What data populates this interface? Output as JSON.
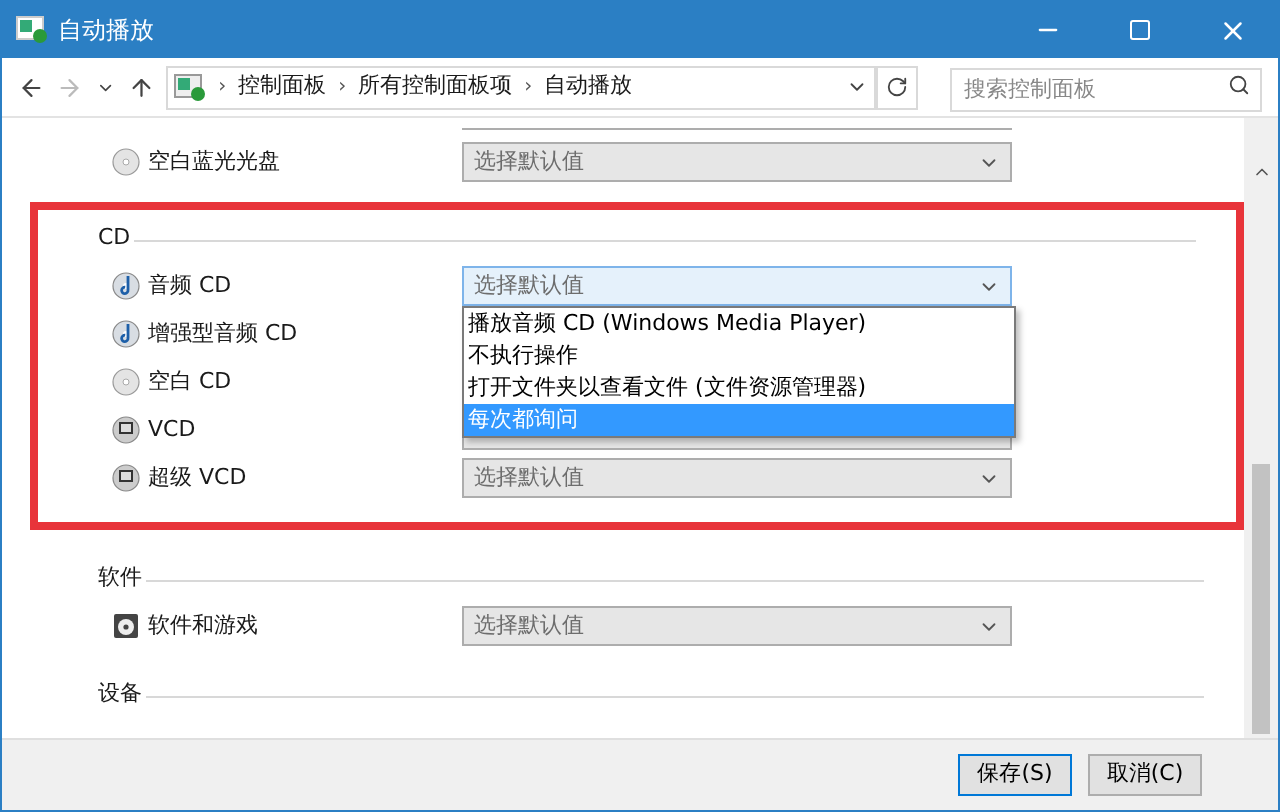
{
  "window": {
    "title": "自动播放"
  },
  "address_bar": {
    "separator": "›",
    "breadcrumbs": [
      "控制面板",
      "所有控制面板项",
      "自动播放"
    ]
  },
  "search": {
    "placeholder": "搜索控制面板"
  },
  "top_row": {
    "label": "空白蓝光光盘",
    "kind": "blank",
    "dropdown": "选择默认值",
    "focused": false
  },
  "sections": [
    {
      "title": "CD",
      "highlighted": true,
      "items": [
        {
          "label": "音频 CD",
          "kind": "audio",
          "dropdown": "选择默认值",
          "focused": true
        },
        {
          "label": "增强型音频 CD",
          "kind": "audio",
          "focused": false
        },
        {
          "label": "空白 CD",
          "kind": "blank",
          "focused": false
        },
        {
          "label": "VCD",
          "kind": "video",
          "has_select": true,
          "focused": false
        },
        {
          "label": "超级 VCD",
          "kind": "video",
          "dropdown": "选择默认值",
          "focused": false
        }
      ]
    },
    {
      "title": "软件",
      "highlighted": false,
      "items": [
        {
          "label": "软件和游戏",
          "kind": "software",
          "dropdown": "选择默认值",
          "focused": false
        }
      ]
    },
    {
      "title": "设备",
      "highlighted": false
    }
  ],
  "dropdown_list": [
    {
      "label": "播放音频 CD (Windows Media Player)",
      "selected": false
    },
    {
      "label": "不执行操作",
      "selected": false
    },
    {
      "label": "打开文件夹以查看文件 (文件资源管理器)",
      "selected": false
    },
    {
      "label": "每次都询问",
      "selected": true
    }
  ],
  "buttons": [
    "保存(S)",
    "取消(C)"
  ]
}
